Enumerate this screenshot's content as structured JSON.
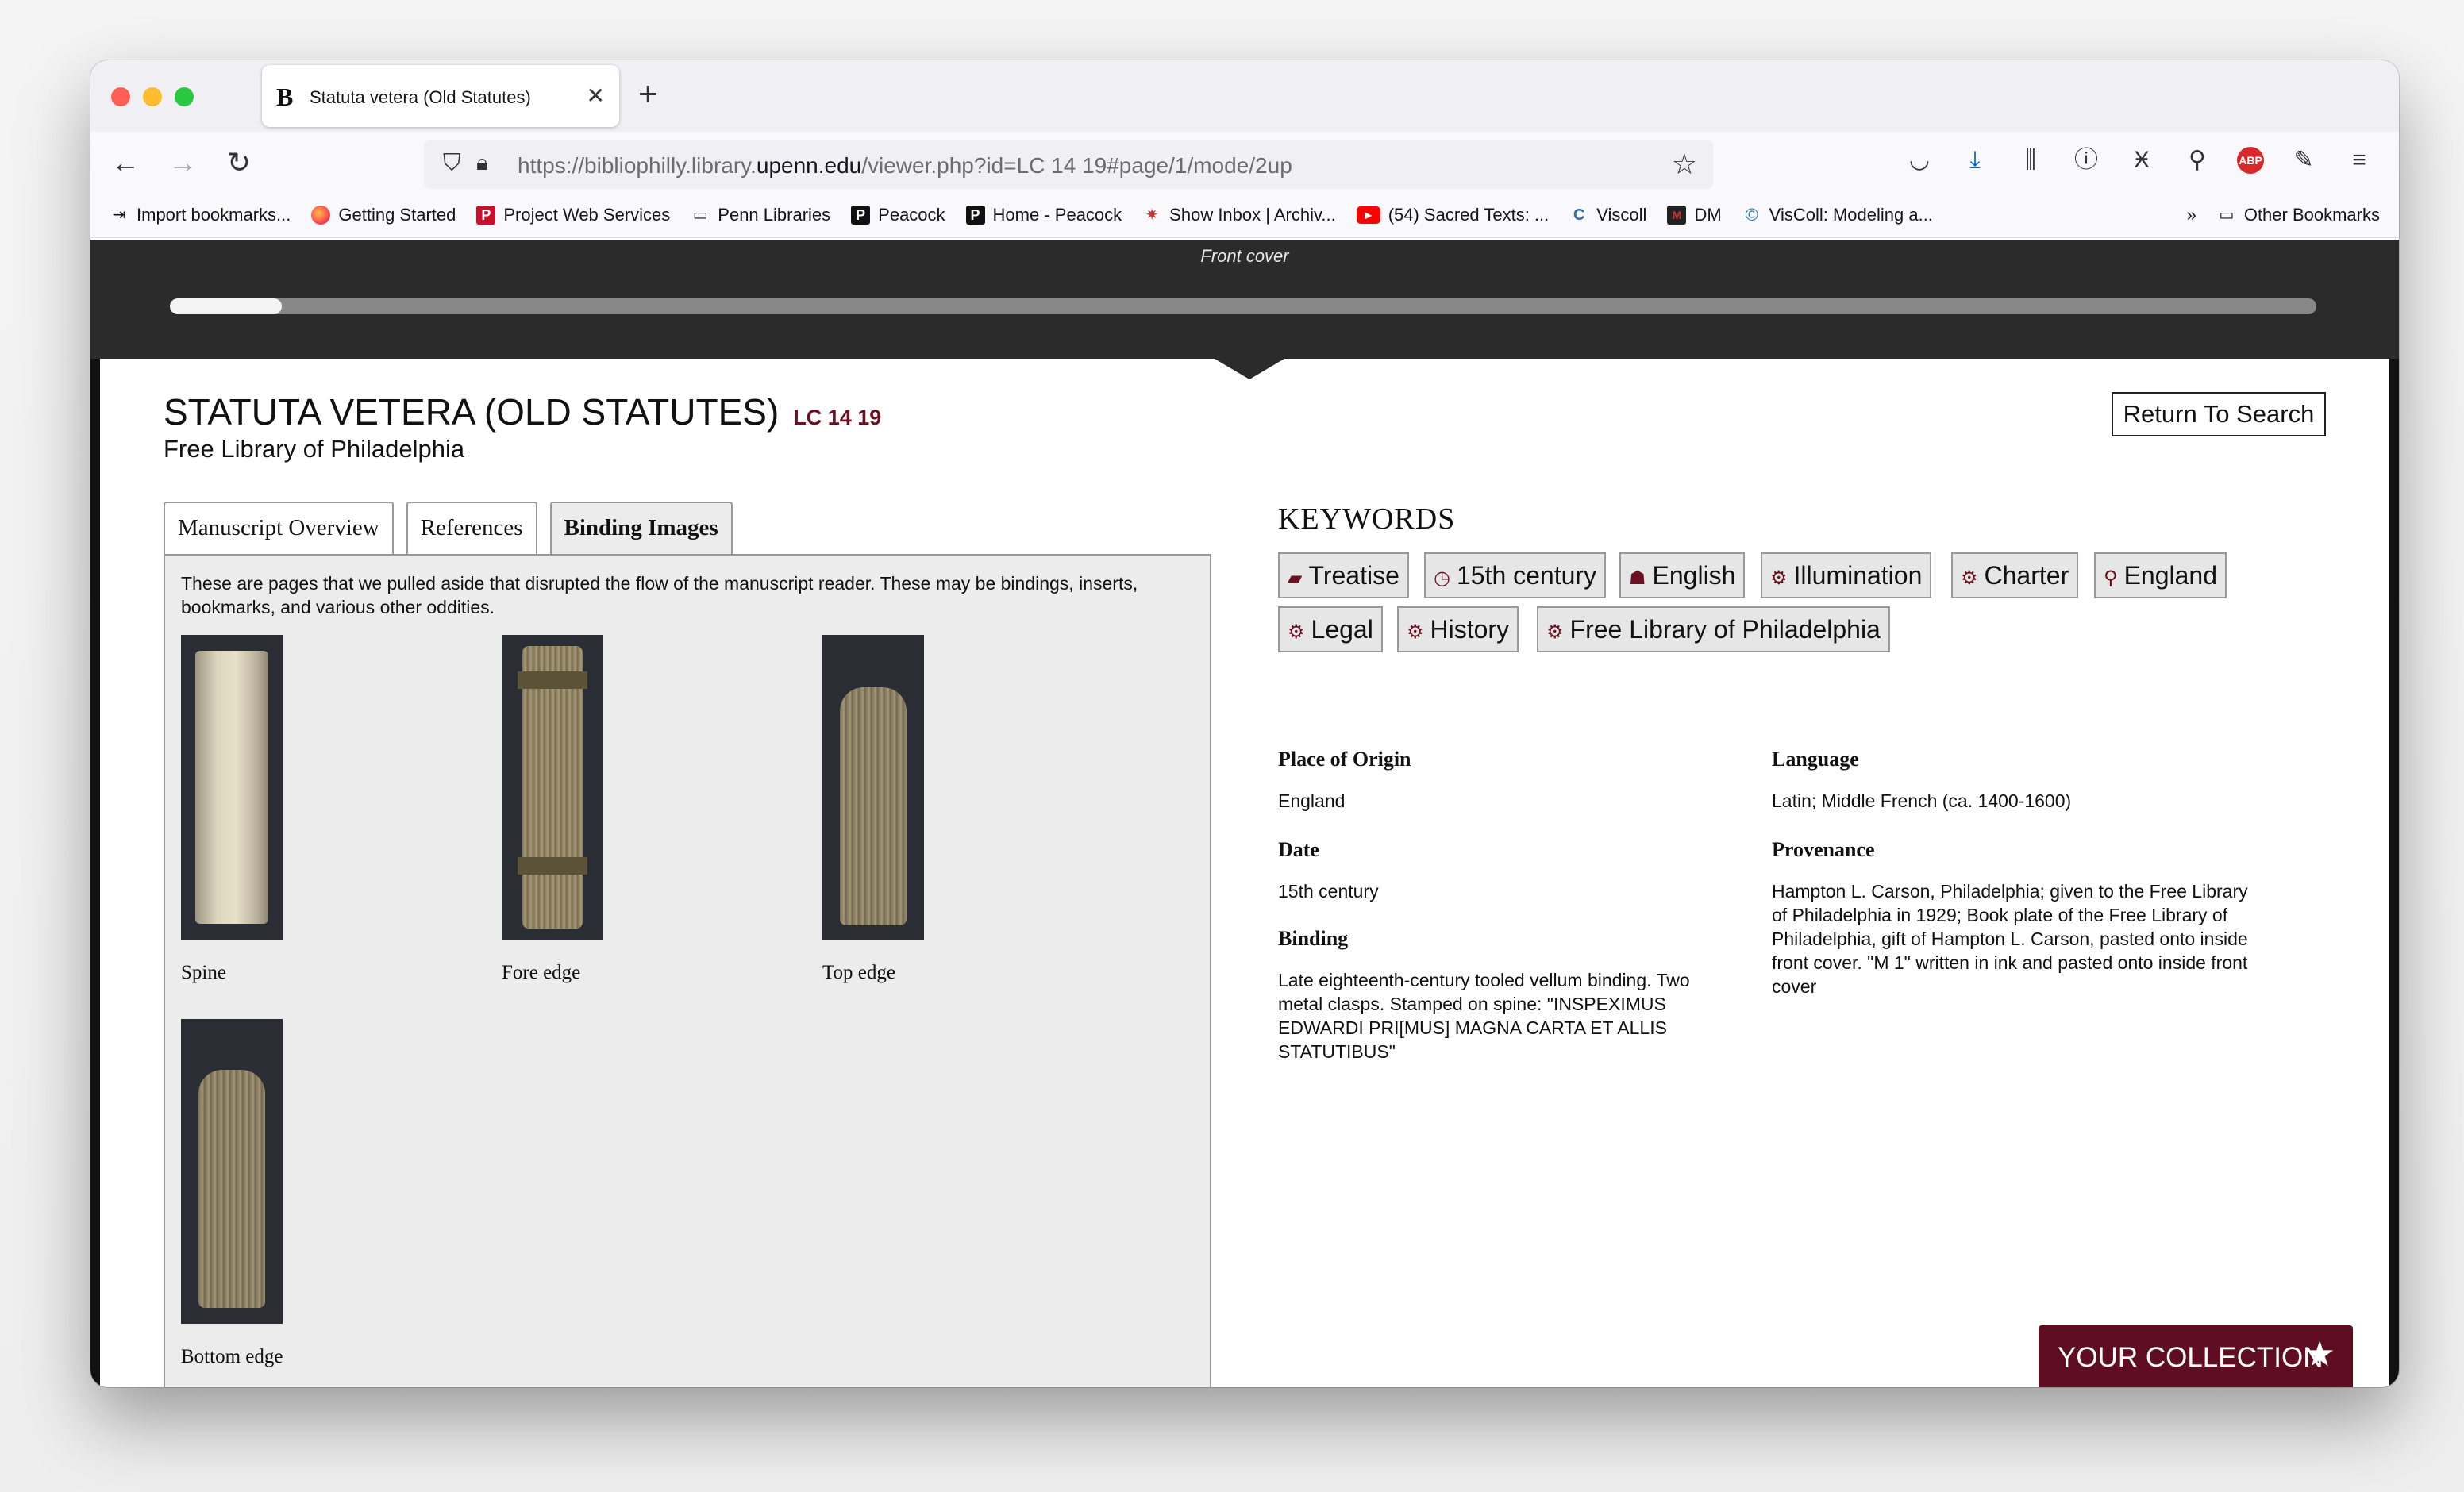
{
  "browser": {
    "tab_title": "Statuta vetera (Old Statutes)",
    "tab_favicon": "B",
    "url_prefix": "https://bibliophilly.library.",
    "url_host": "upenn.edu",
    "url_suffix": "/viewer.php?id=LC 14 19#page/1/mode/2up",
    "bookmarks": [
      {
        "label": "Import bookmarks...",
        "icon": "import-icon"
      },
      {
        "label": "Getting Started",
        "icon": "firefox-icon"
      },
      {
        "label": "Project Web Services",
        "icon": "p-red-icon"
      },
      {
        "label": "Penn Libraries",
        "icon": "folder-icon"
      },
      {
        "label": "Peacock",
        "icon": "p-black-icon"
      },
      {
        "label": "Home - Peacock",
        "icon": "p-black-icon"
      },
      {
        "label": "Show Inbox | Archiv...",
        "icon": "spider-icon"
      },
      {
        "label": "(54) Sacred Texts: ...",
        "icon": "youtube-icon"
      },
      {
        "label": "Viscoll",
        "icon": "viscoll-icon"
      },
      {
        "label": "DM",
        "icon": "dm-icon"
      },
      {
        "label": "VisColl: Modeling a...",
        "icon": "viscoll-modeling-icon"
      }
    ],
    "other_bookmarks": "Other Bookmarks"
  },
  "viewer": {
    "page_label": "Front cover",
    "progress": 0.052
  },
  "manuscript": {
    "title": "STATUTA VETERA (OLD STATUTES)",
    "shelfmark": "LC 14 19",
    "repository": "Free Library of Philadelphia",
    "return_label": "Return To Search"
  },
  "tabs": [
    {
      "label": "Manuscript Overview",
      "active": false
    },
    {
      "label": "References",
      "active": false
    },
    {
      "label": "Binding Images",
      "active": true
    }
  ],
  "binding_panel": {
    "intro": "These are pages that we pulled aside that disrupted the flow of the manuscript reader. These may be bindings, inserts, bookmarks, and various other oddities.",
    "images": [
      {
        "caption": "Spine"
      },
      {
        "caption": "Fore edge"
      },
      {
        "caption": "Top edge"
      },
      {
        "caption": "Bottom edge"
      }
    ]
  },
  "keywords": {
    "title": "KEYWORDS",
    "items": [
      {
        "label": "Treatise",
        "icon": "book-icon"
      },
      {
        "label": "15th century",
        "icon": "clock-icon"
      },
      {
        "label": "English",
        "icon": "users-icon"
      },
      {
        "label": "Illumination",
        "icon": "gears-icon"
      },
      {
        "label": "Charter",
        "icon": "gears-icon"
      },
      {
        "label": "England",
        "icon": "map-marker-icon"
      },
      {
        "label": "Legal",
        "icon": "gears-icon"
      },
      {
        "label": "History",
        "icon": "gears-icon"
      },
      {
        "label": "Free Library of Philadelphia",
        "icon": "gears-icon"
      }
    ]
  },
  "metadata": {
    "place_of_origin": {
      "label": "Place of Origin",
      "value": "England"
    },
    "language": {
      "label": "Language",
      "value": "Latin; Middle French (ca. 1400-1600)"
    },
    "date": {
      "label": "Date",
      "value": "15th century"
    },
    "provenance": {
      "label": "Provenance",
      "value": "Hampton L. Carson, Philadelphia; given to the Free Library of Philadelphia in 1929; Book plate of the Free Library of Philadelphia, gift of Hampton L. Carson, pasted onto inside front cover. \"M 1\" written in ink and pasted onto inside front cover"
    },
    "binding": {
      "label": "Binding",
      "value": "Late eighteenth-century tooled vellum binding. Two metal clasps. Stamped on spine: \"INSPEXIMUS EDWARDI PRI[MUS] MAGNA CARTA ET ALLIS STATUTIBUS\""
    }
  },
  "collection_button": {
    "label": "YOUR COLLECTION",
    "icon": "star-icon"
  },
  "colors": {
    "accent": "#6a1020",
    "collection_bg": "#5e0e20",
    "viewer_bg": "#2b2b2b"
  }
}
